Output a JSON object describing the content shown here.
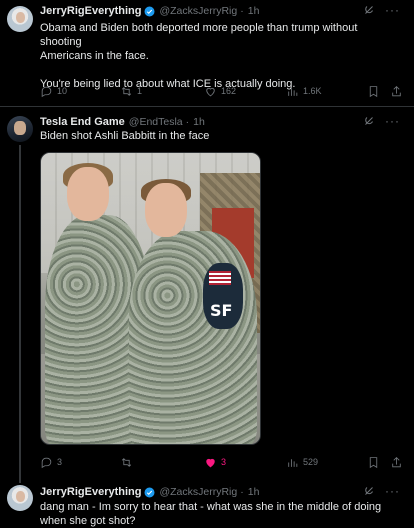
{
  "tweets": [
    {
      "name": "JerryRigEverything",
      "handle": "@ZacksJerryRig",
      "dot": "·",
      "time": "1h",
      "text_lines": [
        "Obama and Biden both deported more people than trump without shooting",
        "Americans in the face.",
        "",
        "You're being lied to about what ICE is actually doing."
      ],
      "replies": "10",
      "reposts": "1",
      "likes": "162",
      "views": "1.6K"
    },
    {
      "name": "Tesla End Game",
      "handle": "@EndTesla",
      "dot": "·",
      "time": "1h",
      "text_lines": [
        "Biden shot Ashli Babbitt in the face"
      ],
      "photo_text": "SF",
      "replies": "3",
      "reposts": "",
      "likes": "3",
      "views": "529"
    },
    {
      "name": "JerryRigEverything",
      "handle": "@ZacksJerryRig",
      "dot": "·",
      "time": "1h",
      "text_lines": [
        "dang man - Im sorry to hear that - what was she in the middle of doing",
        "when she got shot?"
      ]
    }
  ],
  "colors": {
    "background": "#000000",
    "text": "#e7e9ea",
    "muted": "#71767b",
    "verified": "#1d9bf0",
    "like_active": "#f91880",
    "divider": "#2f3336"
  },
  "icons": [
    "verified-badge-icon",
    "grok-icon",
    "more-icon",
    "reply-icon",
    "repost-icon",
    "like-icon",
    "views-icon",
    "bookmark-icon",
    "share-icon"
  ]
}
